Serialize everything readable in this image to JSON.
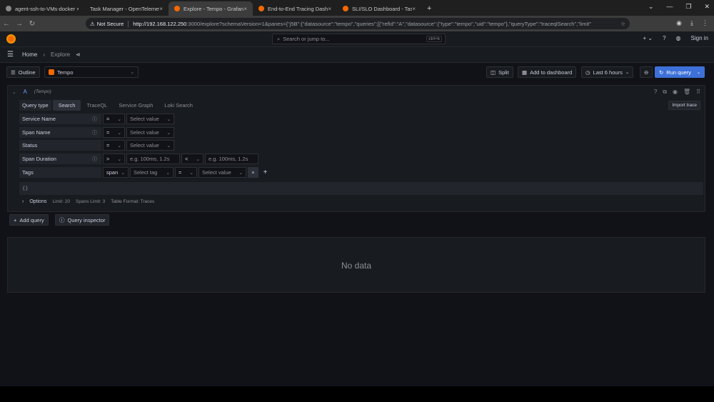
{
  "browser": {
    "tabs": [
      {
        "title": "agent-ssh-to-VMs-docker ×",
        "fav": "gh"
      },
      {
        "title": "Task Manager - OpenTelemet",
        "fav": "none"
      },
      {
        "title": "Explore - Tempo - Grafana",
        "fav": "gf",
        "active": true
      },
      {
        "title": "End-to-End Tracing Dashb",
        "fav": "gf"
      },
      {
        "title": "SLI/SLO Dashboard - Task",
        "fav": "gf"
      }
    ],
    "not_secure": "Not Secure",
    "url_host": "http://192.168.122.250",
    "url_rest": ":3000/explore?schemaVersion=1&panes={\"j5B\":{\"datasource\":\"tempo\",\"queries\":[{\"refId\":\"A\",\"datasource\":{\"type\":\"tempo\",\"uid\":\"tempo\"},\"queryType\":\"traceqlSearch\",\"limit\""
  },
  "grafana": {
    "search_placeholder": "Search or jump to...",
    "search_shortcut": "ctrl+k",
    "sign_in": "Sign in",
    "breadcrumb_home": "Home",
    "breadcrumb_sep": "›",
    "breadcrumb_page": "Explore",
    "outline": "Outline",
    "datasource": "Tempo",
    "split": "Split",
    "add_to_dashboard": "Add to dashboard",
    "time_range": "Last 6 hours",
    "run_query": "Run query"
  },
  "query": {
    "ref": "A",
    "ds_label": "(Tempo)",
    "import_trace": "Import trace",
    "query_type_label": "Query type",
    "query_types": [
      "Search",
      "TraceQL",
      "Service Graph",
      "Loki Search"
    ],
    "rows": {
      "service_name": {
        "label": "Service Name",
        "op": "=",
        "value": "Select value"
      },
      "span_name": {
        "label": "Span Name",
        "op": "=",
        "value": "Select value"
      },
      "status": {
        "label": "Status",
        "op": "=",
        "value": "Select value"
      },
      "duration": {
        "label": "Span Duration",
        "op1": ">",
        "ph1": "e.g. 100ms, 1.2s",
        "op2": "<",
        "ph2": "e.g. 100ms, 1.2s"
      },
      "tags": {
        "label": "Tags",
        "scope": "span",
        "tag": "Select tag",
        "op": "=",
        "value": "Select value"
      }
    },
    "traceql": "{}",
    "options_label": "Options",
    "limit": "Limit: 20",
    "spans_limit": "Spans Limit: 3",
    "table_format": "Table Format: Traces"
  },
  "actions": {
    "add_query": "Add query",
    "query_inspector": "Query inspector"
  },
  "result": {
    "no_data": "No data"
  },
  "colors": {
    "accent": "#3d71d9",
    "brand": "#f46800"
  }
}
